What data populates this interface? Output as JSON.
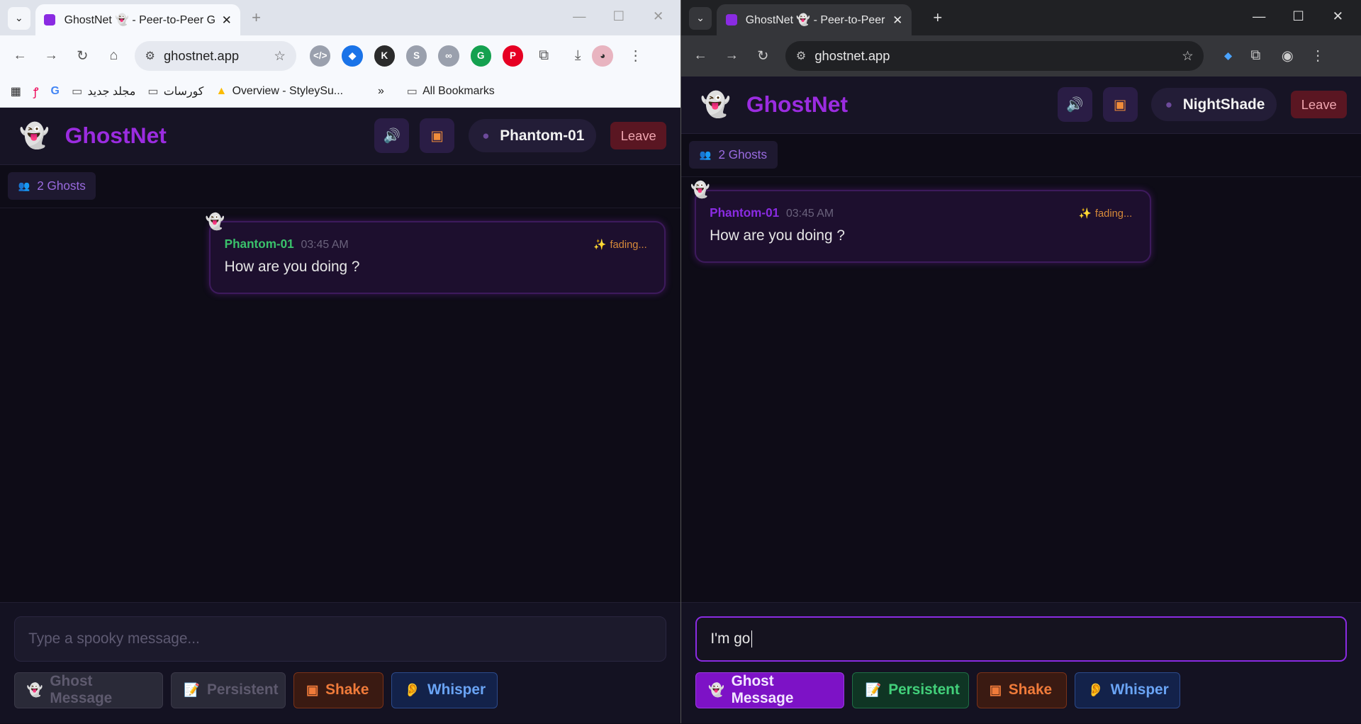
{
  "left": {
    "tab_title": "GhostNet 👻 - Peer-to-Peer Gh",
    "url": "ghostnet.app",
    "bookmarks": [
      "مجلد جديد",
      "كورسات",
      "Overview - StyleySu...",
      "All Bookmarks"
    ],
    "app_title": "GhostNet",
    "user": "Phantom-01",
    "leave": "Leave",
    "ghost_count": "2 Ghosts",
    "message": {
      "author": "Phantom-01",
      "time": "03:45 AM",
      "status": "fading...",
      "text": "How are you doing ?"
    },
    "input_placeholder": "Type a spooky message...",
    "buttons": {
      "ghost": "Ghost Message",
      "persistent": "Persistent",
      "shake": "Shake",
      "whisper": "Whisper"
    }
  },
  "right": {
    "tab_title": "GhostNet 👻 - Peer-to-Peer Gh",
    "url": "ghostnet.app",
    "app_title": "GhostNet",
    "user": "NightShade",
    "leave": "Leave",
    "ghost_count": "2 Ghosts",
    "message": {
      "author": "Phantom-01",
      "time": "03:45 AM",
      "status": "fading...",
      "text": "How are you doing ?"
    },
    "input_value": "I'm go",
    "buttons": {
      "ghost": "Ghost Message",
      "persistent": "Persistent",
      "shake": "Shake",
      "whisper": "Whisper"
    }
  },
  "colors": {
    "accent": "#9b2ce0",
    "author": "#3ac26b",
    "background": "#0e0c17"
  }
}
